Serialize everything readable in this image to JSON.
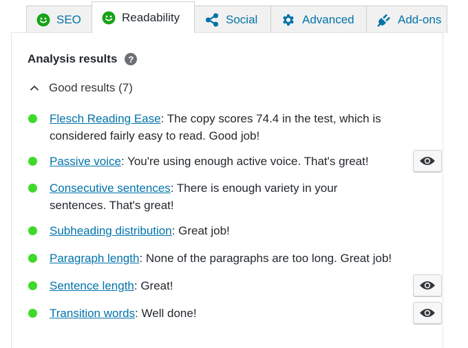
{
  "tabs": [
    {
      "label": "SEO",
      "icon": "smiley-icon",
      "active": false
    },
    {
      "label": "Readability",
      "icon": "smiley-icon",
      "active": true
    },
    {
      "label": "Social",
      "icon": "share-icon",
      "active": false
    },
    {
      "label": "Advanced",
      "icon": "gear-icon",
      "active": false
    },
    {
      "label": "Add-ons",
      "icon": "plug-icon",
      "active": false
    }
  ],
  "colors": {
    "good": "#3ed92a",
    "link": "#0073aa",
    "smiley": "#17a317"
  },
  "analysis": {
    "title": "Analysis results",
    "group_label": "Good results (7)",
    "results": [
      {
        "link": "Flesch Reading Ease",
        "text": ": The copy scores 74.4 in the test, which is considered fairly easy to read. Good job!",
        "has_eye": false
      },
      {
        "link": "Passive voice",
        "text": ": You're using enough active voice. That's great!",
        "has_eye": true
      },
      {
        "link": "Consecutive sentences",
        "text": ": There is enough variety in your sentences. That's great!",
        "has_eye": false
      },
      {
        "link": "Subheading distribution",
        "text": ": Great job!",
        "has_eye": false
      },
      {
        "link": "Paragraph length",
        "text": ": None of the paragraphs are too long. Great job!",
        "has_eye": false
      },
      {
        "link": "Sentence length",
        "text": ": Great!",
        "has_eye": true
      },
      {
        "link": "Transition words",
        "text": ": Well done!",
        "has_eye": true
      }
    ]
  }
}
